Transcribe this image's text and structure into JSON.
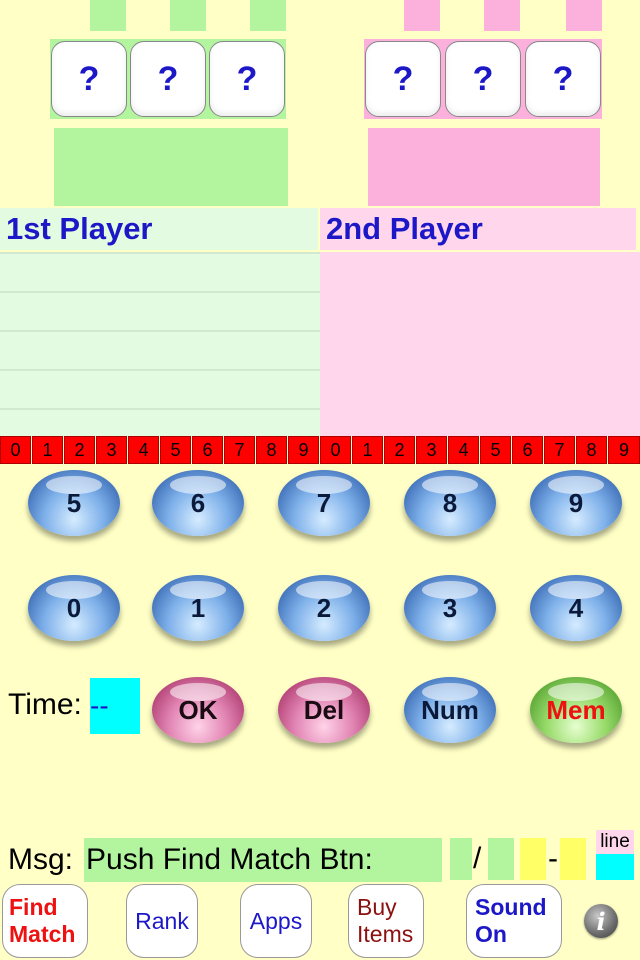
{
  "colors": {
    "background": "#ffffc6",
    "player1": "#b3f59e",
    "player2": "#fbb1dc",
    "title_blue": "#1c18c8",
    "digit_strip": "#ff0000",
    "time_box": "#00ffff",
    "msg_box": "#b3f59e"
  },
  "player1": {
    "name": "1st Player",
    "hidden_digits": [
      "?",
      "?",
      "?"
    ]
  },
  "player2": {
    "name": "2nd Player",
    "hidden_digits": [
      "?",
      "?",
      "?"
    ]
  },
  "digit_strip": [
    "0",
    "1",
    "2",
    "3",
    "4",
    "5",
    "6",
    "7",
    "8",
    "9",
    "0",
    "1",
    "2",
    "3",
    "4",
    "5",
    "6",
    "7",
    "8",
    "9"
  ],
  "keypad": {
    "row1": [
      "5",
      "6",
      "7",
      "8",
      "9"
    ],
    "row2": [
      "0",
      "1",
      "2",
      "3",
      "4"
    ]
  },
  "controls": {
    "time_label": "Time:",
    "time_value": "--",
    "ok": "OK",
    "del": "Del",
    "num": "Num",
    "mem": "Mem"
  },
  "message": {
    "label": "Msg:",
    "text": "Push Find Match Btn:",
    "slash": "/",
    "dash": "-",
    "line_label": "line"
  },
  "bottom_bar": {
    "find_match": [
      "Find",
      "Match"
    ],
    "rank": "Rank",
    "apps": "Apps",
    "buy_items": [
      "Buy",
      "Items"
    ],
    "sound": [
      "Sound",
      "On"
    ],
    "info_icon": "i"
  }
}
